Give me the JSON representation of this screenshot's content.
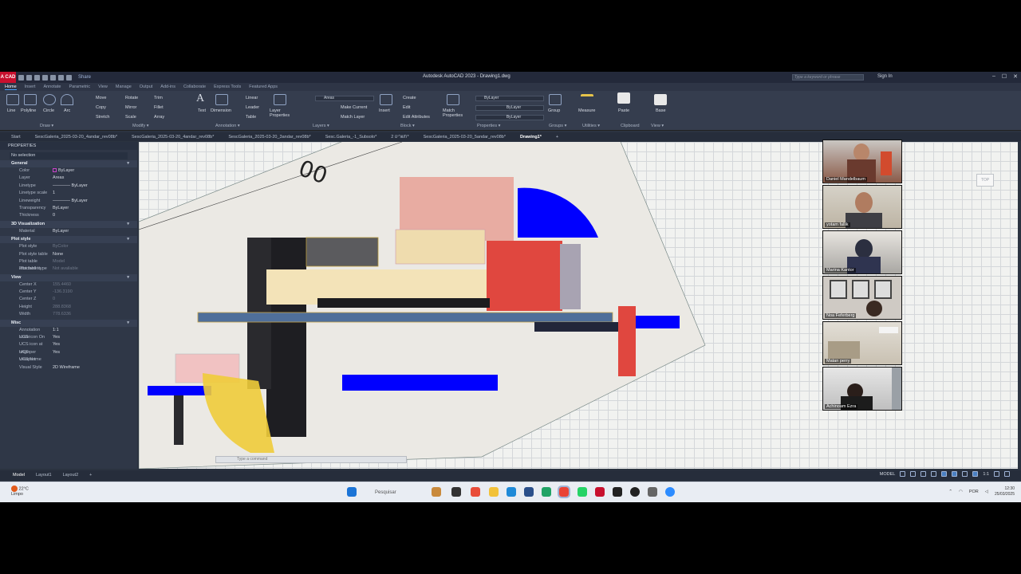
{
  "window": {
    "app_badge": "A CAD",
    "title": "Autodesk AutoCAD 2023 - Drawing1.dwg",
    "share": "Share",
    "search_placeholder": "Type a keyword or phrase",
    "sign_in": "Sign In"
  },
  "ribbon_tabs": [
    "Home",
    "Insert",
    "Annotate",
    "Parametric",
    "View",
    "Manage",
    "Output",
    "Add-ins",
    "Collaborate",
    "Express Tools",
    "Featured Apps"
  ],
  "ribbon": {
    "draw": {
      "items": [
        "Line",
        "Polyline",
        "Circle",
        "Arc"
      ],
      "label": "Draw ▾"
    },
    "modify": {
      "items": [
        "Move",
        "Rotate",
        "Trim",
        "Copy",
        "Mirror",
        "Fillet",
        "Stretch",
        "Scale",
        "Array"
      ],
      "label": "Modify ▾"
    },
    "annotation": {
      "items": [
        "Text",
        "Dimension",
        "Linear",
        "Leader",
        "Table"
      ],
      "label": "Annotation ▾"
    },
    "layers": {
      "items": [
        "Layer Properties",
        "Make Current",
        "Match Layer"
      ],
      "current_layer": "Areas",
      "label": "Layers ▾"
    },
    "block": {
      "items": [
        "Insert",
        "Create",
        "Edit",
        "Edit Attributes"
      ],
      "label": "Block ▾"
    },
    "properties": {
      "items": [
        "Match Properties"
      ],
      "color": "ByLayer",
      "linetype": "ByLayer",
      "lineweight": "ByLayer",
      "label": "Properties ▾"
    },
    "groups": {
      "items": [
        "Group"
      ],
      "label": "Groups ▾"
    },
    "utilities": {
      "items": [
        "Measure"
      ],
      "label": "Utilities ▾"
    },
    "clipboard": {
      "items": [
        "Paste"
      ],
      "label": "Clipboard"
    },
    "view": {
      "items": [
        "Base"
      ],
      "label": "View ▾"
    }
  },
  "file_tabs": [
    "Start",
    "SescGaleria_2025-03-20_4andar_rev08b*",
    "SescGaleria_2025-03-20_4andar_rev08b*",
    "SescGaleria_2025-03-20_3andar_rev08b*",
    "Sesc.Galeria_-1_Subsolo*",
    "תשריט 2*",
    "SescGaleria_2025-03-20_5andar_rev08b*",
    "Drawing1*"
  ],
  "properties_panel": {
    "title": "PROPERTIES",
    "selection": "No selection",
    "sections": [
      {
        "name": "General",
        "rows": [
          [
            "Color",
            "ByLayer"
          ],
          [
            "Layer",
            "Areas"
          ],
          [
            "Linetype",
            "———— ByLayer"
          ],
          [
            "Linetype scale",
            "1"
          ],
          [
            "Lineweight",
            "———— ByLayer"
          ],
          [
            "Transparency",
            "ByLayer"
          ],
          [
            "Thickness",
            "0"
          ]
        ]
      },
      {
        "name": "3D Visualization",
        "rows": [
          [
            "Material",
            "ByLayer"
          ]
        ]
      },
      {
        "name": "Plot style",
        "rows": [
          [
            "Plot style",
            "ByColor"
          ],
          [
            "Plot style table",
            "None"
          ],
          [
            "Plot table attached to",
            "Model"
          ],
          [
            "Plot table type",
            "Not available"
          ]
        ]
      },
      {
        "name": "View",
        "rows": [
          [
            "Center X",
            "155.4460"
          ],
          [
            "Center Y",
            "-136.3190"
          ],
          [
            "Center Z",
            "0"
          ],
          [
            "Height",
            "288.8368"
          ],
          [
            "Width",
            "778.6336"
          ]
        ]
      },
      {
        "name": "Misc",
        "rows": [
          [
            "Annotation scale",
            "1:1"
          ],
          [
            "UCS icon On",
            "Yes"
          ],
          [
            "UCS icon at origin",
            "Yes"
          ],
          [
            "UCS per viewport",
            "Yes"
          ],
          [
            "UCS Name",
            ""
          ],
          [
            "Visual Style",
            "2D Wireframe"
          ]
        ]
      }
    ]
  },
  "drawing": {
    "text_mark": "00",
    "viewcube_label": "TOP",
    "command_placeholder": "Type a command"
  },
  "participants": [
    "Daniel Mandelbaum",
    "yotam fallik",
    "Marina Kantor",
    "Noa Feferberg",
    "Matan perry",
    "Achinoam Ezra"
  ],
  "layout_tabs": [
    "Model",
    "Layout1",
    "Layout2",
    "+"
  ],
  "statusbar": {
    "model": "MODEL",
    "scale": "1:1"
  },
  "taskbar": {
    "weather_temp": "22°C",
    "weather_desc": "Limpo",
    "search": "Pesquisar",
    "lang": "POR",
    "time": "12:30",
    "date": "25/03/2025"
  },
  "colors": {
    "accent": "#4aa3ff",
    "blue": "#0000ff",
    "red": "#e0473f",
    "dark": "#1e1e22"
  }
}
